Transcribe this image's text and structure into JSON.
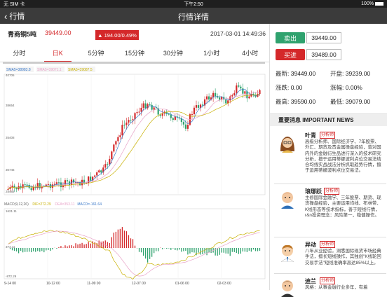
{
  "status": {
    "carrier": "无 SIM 卡 ",
    "time": "下午2:50",
    "battery": "100%"
  },
  "nav": {
    "back_label": "行情",
    "title": "行情详情"
  },
  "instrument": {
    "name": "青商铜5吨",
    "price": "39449.00",
    "change": "194.00/0.49%",
    "datetime": "2017-03-01 14:49:36"
  },
  "tabs": [
    {
      "label": "分时",
      "active": false
    },
    {
      "label": "日K",
      "active": true
    },
    {
      "label": "5分钟",
      "active": false
    },
    {
      "label": "15分钟",
      "active": false
    },
    {
      "label": "30分钟",
      "active": false
    },
    {
      "label": "1小时",
      "active": false
    },
    {
      "label": "4小时",
      "active": false
    }
  ],
  "chart_data": {
    "type": "candlestick",
    "legend_main": [
      {
        "name": "SMA5=38983.8",
        "color": "#3a78c8"
      },
      {
        "name": "SMA5=39071.1",
        "color": "#e8a3c8"
      },
      {
        "name": "SMA5=39087.5",
        "color": "#c8b000"
      }
    ],
    "y_ticks_main": [
      "40706",
      "38654",
      "35408",
      "30746",
      "28488"
    ],
    "legend_macd": [
      {
        "name": "MACD(9,12,26)",
        "color": "#666"
      },
      {
        "name": "DIF=272.29",
        "color": "#c8b000"
      },
      {
        "name": "DEA=353.11",
        "color": "#e8a3c8"
      },
      {
        "name": "MACD=-161.64",
        "color": "#3a78c8"
      }
    ],
    "y_ticks_macd": [
      "1621.11",
      "374.11",
      "-872.29"
    ],
    "x_ticks": [
      "9-14 00",
      "10-12 00",
      "11-09 00",
      "12-07 00",
      "01-06 00",
      "02-03 00"
    ]
  },
  "quote": {
    "sell_label": "卖出",
    "sell_value": "39449.00",
    "buy_label": "买进",
    "buy_value": "39489.00",
    "rows": [
      {
        "k1": "最新:",
        "v1": "39449.00",
        "k2": "开盘:",
        "v2": "39239.00"
      },
      {
        "k1": "涨跌:",
        "v1": "0.00",
        "k2": "涨幅:",
        "v2": "0.00%"
      },
      {
        "k1": "最高:",
        "v1": "39590.00",
        "k2": "最低:",
        "v2": "39079.00"
      }
    ]
  },
  "news": {
    "title": "重要消息 IMPORTANT NEWS",
    "analysts": [
      {
        "name": "叶青",
        "tag": "分析师",
        "desc": "高级分析师、国际经济学、7年股票、外汇、期货及贵金属操盘经验，曾对国内外的金融衍生品进行深入的技术研究分析，擅于运用蒂娜波利点位交易法结合均线实战战法分析抓取趋势行情，擅于运用蒂娜波利点位交易法。"
      },
      {
        "name": "琅琊跃",
        "tag": "分析师",
        "desc": "主修国际金融学、三年股票、期货、现货操盘经验，主要运用均线、布林带、K线形态等技术指标，善于短线行情，r&n投资理念：风险第一，稳健操作。"
      },
      {
        "name": "异动",
        "tag": "分析师",
        "desc": "八年从业经验，洞悉国际现货市场经典手法，擅长短线操作，其独创\"K线轮回交易手法\"短线准确率高达85%以上。"
      },
      {
        "name": "迪兰",
        "tag": "分析师",
        "desc": "风格：从事金融行业多年，有着"
      }
    ]
  }
}
